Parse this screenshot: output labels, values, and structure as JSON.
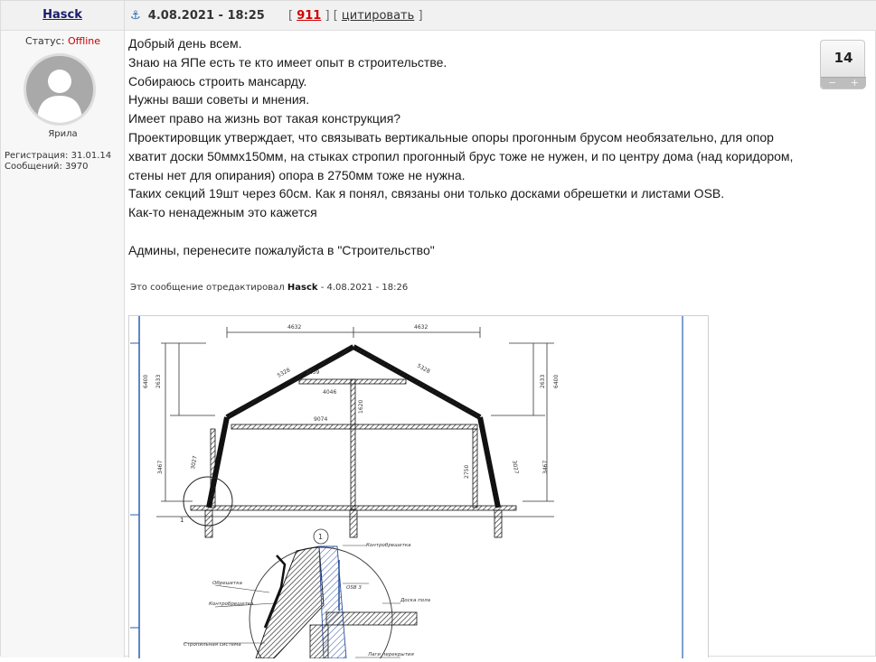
{
  "post": {
    "author": "Hasck",
    "date": "4.08.2021 - 18:25",
    "post_number": "911",
    "quote_label": "цитировать",
    "bracket_open": "[",
    "bracket_close": "]"
  },
  "user": {
    "status_label": "Статус:",
    "status_value": "Offline",
    "status_color": "#cc0000",
    "user_title": "Ярила",
    "registration": "Регистрация: 31.01.14",
    "messages": "Сообщений: 3970"
  },
  "rating": {
    "value": "14",
    "minus": "−",
    "plus": "+"
  },
  "body": {
    "lines": [
      "Добрый день всем.",
      "Знаю на ЯПе есть те кто имеет опыт в строительстве.",
      "Собираюсь строить мансарду.",
      "Нужны ваши советы и мнения.",
      "Имеет право на жизнь вот такая конструкция?",
      "Проектировщик утверждает, что связывать вертикальные опоры прогонным брусом необязательно, для опор хватит доски 50ммх150мм, на стыках стропил прогонный брус тоже не нужен, и по центру дома (над коридором, стены нет для опирания) опора в 2750мм тоже не нужна.",
      "Таких секций 19шт через 60см. Как я понял, связаны они только досками обрешетки и листами OSB.",
      "Как-то ненадежным это кажется"
    ],
    "admin_request": "Админы, перенесите пожалуйста в \"Строительство\""
  },
  "edited": {
    "prefix": "Это сообщение отредактировал",
    "editor": "Hasck",
    "suffix": "- 4.08.2021 - 18:26"
  },
  "drawing": {
    "dims": {
      "top_left": "4632",
      "top_right": "4632",
      "rafter_left": "5328",
      "rafter_right": "5328",
      "collar": "3159",
      "collar_inner": "4046",
      "post_height": "1620",
      "floor_span": "9074",
      "left_top": "2633",
      "left_total": "6400",
      "right_top": "2633",
      "right_total": "6400",
      "left_wall": "3467",
      "right_wall": "3467",
      "left_slope": "3027",
      "right_slope": "3027",
      "center_post": "2750",
      "node": "1"
    },
    "detail_labels": {
      "counter_batten": "Контробрешетка",
      "osb": "OSB 3",
      "board": "Доска пола",
      "lathing": "Обрешетка",
      "counter_lathing": "Контробрешетка",
      "rafter_system": "Стропильная система",
      "joists": "Лаги перекрытия"
    }
  }
}
